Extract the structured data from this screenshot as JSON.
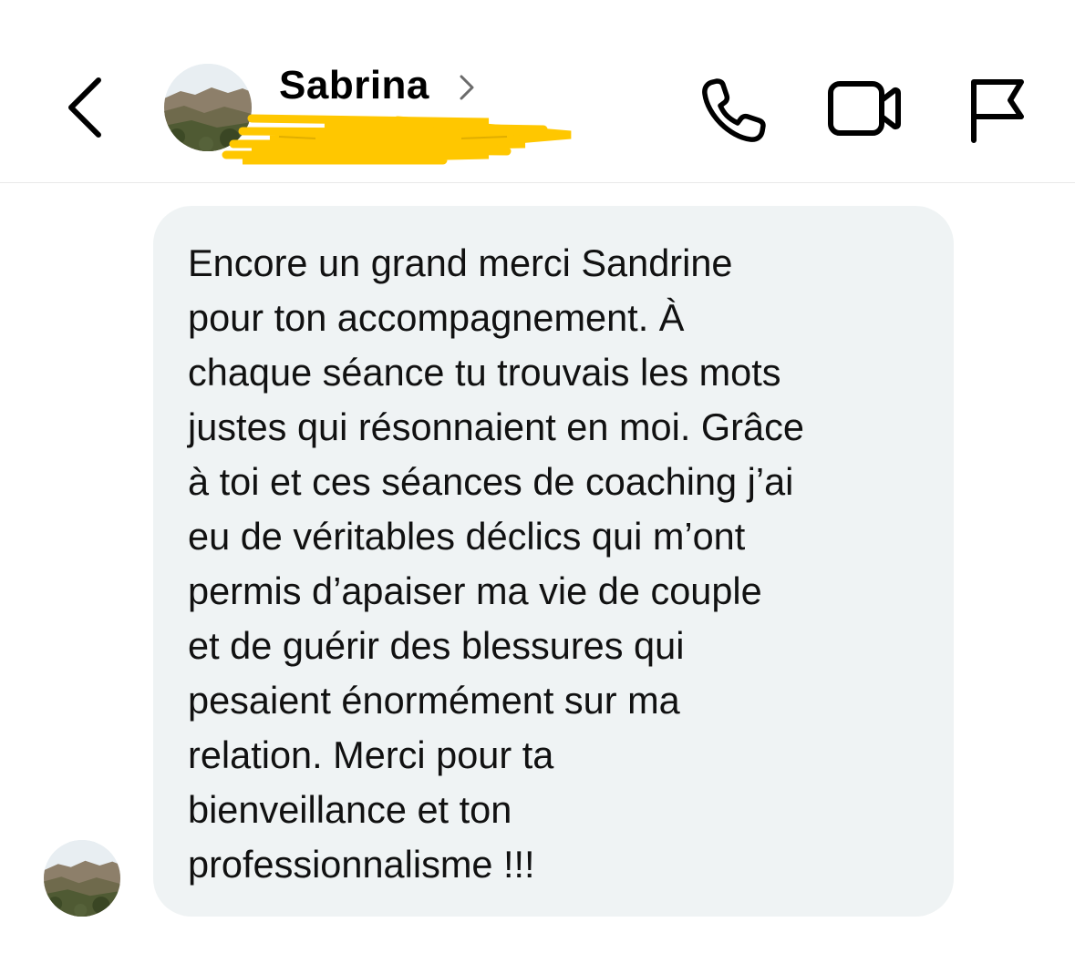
{
  "header": {
    "contact_name": "Sabrina",
    "back_icon": "chevron-left-icon",
    "name_chevron_icon": "chevron-right-icon",
    "actions": [
      {
        "name": "phone-call-button",
        "icon": "phone-icon"
      },
      {
        "name": "video-call-button",
        "icon": "video-camera-icon"
      },
      {
        "name": "report-flag-button",
        "icon": "flag-icon"
      }
    ],
    "redaction_color": "#ffc700"
  },
  "conversation": {
    "bubble_color": "#eff3f4",
    "message": "Encore un grand merci Sandrine\npour ton accompagnement. À\nchaque séance tu trouvais les mots\njustes qui résonnaient en moi. Grâce\nà toi et ces séances de coaching  j’ai\neu de véritables déclics qui m’ont\npermis d’apaiser ma vie de couple\net de guérir des blessures qui\npesaient énormément sur ma\nrelation. Merci pour ta\nbienveillance et ton\nprofessionnalisme !!!"
  }
}
